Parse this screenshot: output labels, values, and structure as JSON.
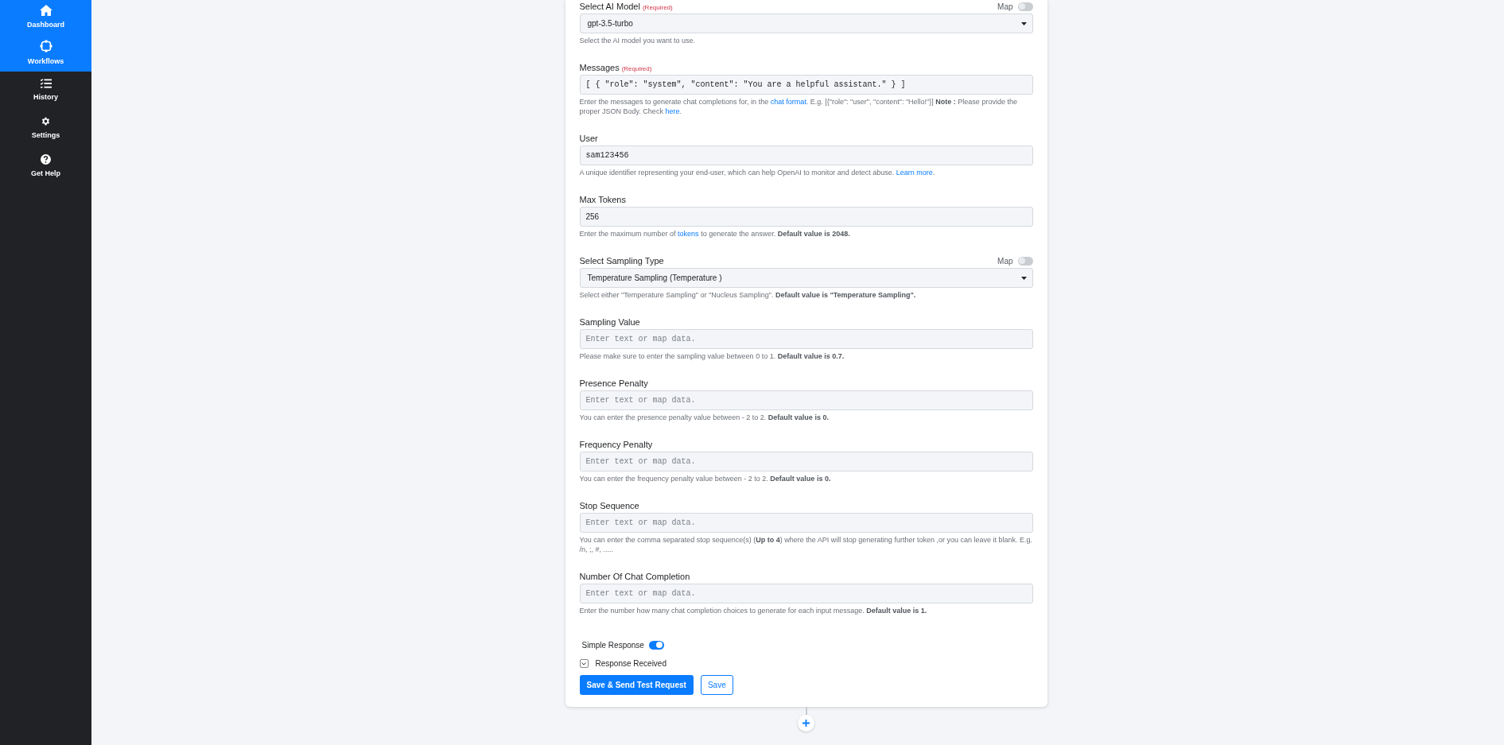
{
  "sidebar": {
    "items": [
      {
        "label": "Dashboard",
        "kind": "home",
        "selected": true
      },
      {
        "label": "Workflows",
        "kind": "workflow",
        "selected": true
      },
      {
        "label": "History",
        "kind": "list",
        "selected": false
      },
      {
        "label": "Settings",
        "kind": "gear",
        "selected": false
      },
      {
        "label": "Get Help",
        "kind": "help",
        "selected": false
      }
    ]
  },
  "form": {
    "fields": [
      {
        "kind": "select",
        "label": "Select AI Model",
        "required": "(Required)",
        "map": {
          "label": "Map",
          "on": false
        },
        "value": "gpt-3.5-turbo",
        "help": [
          {
            "kind": "text",
            "text": "Select the AI model you want to use."
          }
        ]
      },
      {
        "kind": "code",
        "label": "Messages",
        "required": "(Required)",
        "value": "[ { \"role\": \"system\", \"content\": \"You are a helpful assistant.\" } ]",
        "help": [
          {
            "kind": "text",
            "text": "Enter the messages to generate chat completions for, in the"
          },
          {
            "kind": "link",
            "text": "chat format"
          },
          {
            "kind": "text",
            "text": ". E.g. [{\"role\": \"user\", \"content\": \"Hello!\"}]"
          },
          {
            "kind": "bold",
            "text": "Note :"
          },
          {
            "kind": "text",
            "text": "Please provide the proper JSON Body. Check"
          },
          {
            "kind": "link",
            "text": "here"
          },
          {
            "kind": "text",
            "text": "."
          }
        ]
      },
      {
        "kind": "code",
        "label": "User",
        "value": "sam123456",
        "help": [
          {
            "kind": "text",
            "text": "A unique identifier representing your end-user, which can help OpenAI to monitor and detect abuse."
          },
          {
            "kind": "link",
            "text": "Learn more"
          },
          {
            "kind": "text",
            "text": "."
          }
        ]
      },
      {
        "kind": "text",
        "label": "Max Tokens",
        "value": "256",
        "help": [
          {
            "kind": "text",
            "text": "Enter the maximum number of"
          },
          {
            "kind": "link",
            "text": "tokens"
          },
          {
            "kind": "text",
            "text": "to generate the answer."
          },
          {
            "kind": "bold",
            "text": "Default value is 2048."
          }
        ]
      },
      {
        "kind": "select",
        "label": "Select Sampling Type",
        "map": {
          "label": "Map",
          "on": false
        },
        "value": "Temperature Sampling (Temperature )",
        "help": [
          {
            "kind": "text",
            "text": "Select either \"Temperature Sampling\" or \"Nucleus Sampling\"."
          },
          {
            "kind": "bold",
            "text": "Default value is \"Temperature Sampling\"."
          }
        ]
      },
      {
        "kind": "text",
        "label": "Sampling Value",
        "placeholder": "Enter text or map data.",
        "help": [
          {
            "kind": "text",
            "text": "Please make sure to enter the sampling value between 0 to 1."
          },
          {
            "kind": "bold",
            "text": "Default value is 0.7."
          }
        ]
      },
      {
        "kind": "text",
        "label": "Presence Penalty",
        "placeholder": "Enter text or map data.",
        "help": [
          {
            "kind": "text",
            "text": "You can enter the presence penalty value between - 2 to 2."
          },
          {
            "kind": "bold",
            "text": "Default value is 0."
          }
        ]
      },
      {
        "kind": "text",
        "label": "Frequency Penalty",
        "placeholder": "Enter text or map data.",
        "help": [
          {
            "kind": "text",
            "text": "You can enter the frequency penalty value between - 2 to 2."
          },
          {
            "kind": "bold",
            "text": "Default value is 0."
          }
        ]
      },
      {
        "kind": "text",
        "label": "Stop Sequence",
        "placeholder": "Enter text or map data.",
        "help": [
          {
            "kind": "text",
            "text": "You can enter the comma separated stop sequence(s) ("
          },
          {
            "kind": "bold",
            "text": "Up to 4"
          },
          {
            "kind": "text",
            "text": ") where the API will stop generating further token ,or you can leave it blank. E.g. /n, ;, #, ....."
          }
        ]
      },
      {
        "kind": "text",
        "label": "Number Of Chat Completion",
        "placeholder": "Enter text or map data.",
        "help": [
          {
            "kind": "text",
            "text": "Enter the number how many chat completion choices to generate for each input message."
          },
          {
            "kind": "bold",
            "text": "Default value is 1."
          }
        ]
      }
    ],
    "simple_response": {
      "label": "Simple Response",
      "on": true
    },
    "response_received": {
      "label": "Response Received",
      "expanded": false
    },
    "buttons": [
      {
        "kind": "primary",
        "label": "Save & Send Test Request"
      },
      {
        "kind": "outline",
        "label": "Save"
      }
    ]
  }
}
